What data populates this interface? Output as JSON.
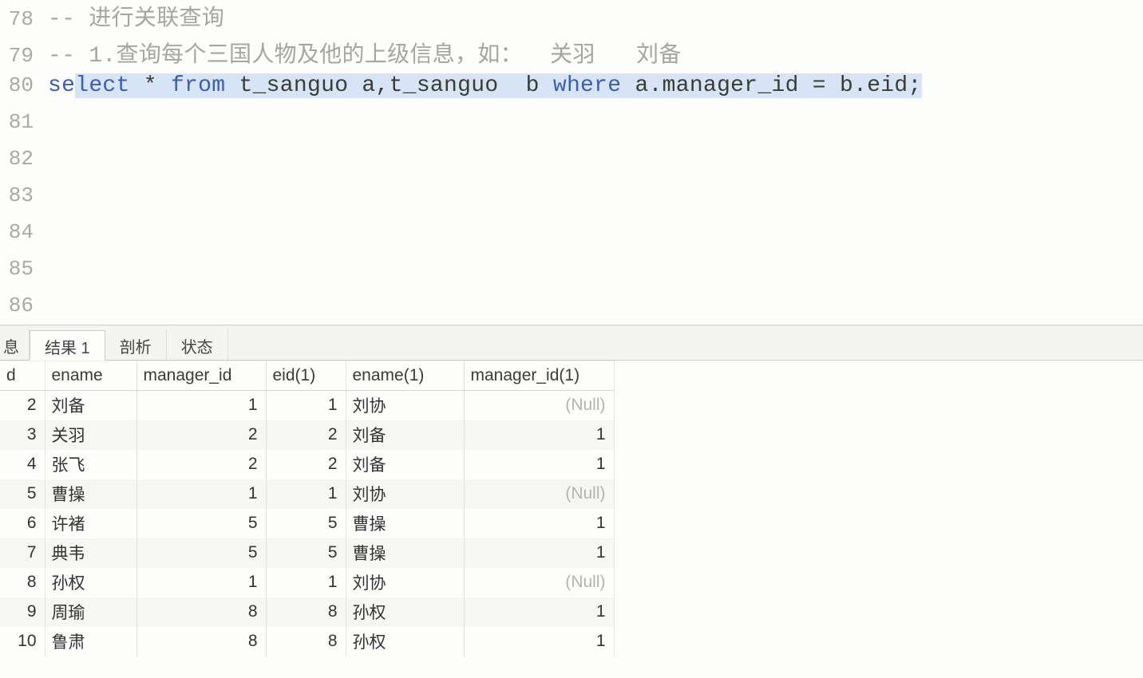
{
  "editor": {
    "lines": [
      {
        "n": "78",
        "tokens": [
          {
            "cls": "cm",
            "t": "-- 进行关联查询"
          }
        ]
      },
      {
        "n": "79",
        "tokens": [
          {
            "cls": "cm",
            "t": "-- 1.查询每个三国人物及他的上级信息，如：  关羽   刘备"
          }
        ]
      },
      {
        "n": "80",
        "selected": true,
        "unselPrefix": "se",
        "tokens": [
          {
            "cls": "kw",
            "t": "lect"
          },
          {
            "cls": "id",
            "t": " * "
          },
          {
            "cls": "kw",
            "t": "from"
          },
          {
            "cls": "id",
            "t": " t_sanguo a,t_sanguo  b "
          },
          {
            "cls": "kw",
            "t": "where"
          },
          {
            "cls": "id",
            "t": " a.manager_id = b.eid;"
          }
        ]
      },
      {
        "n": "81",
        "tokens": []
      },
      {
        "n": "82",
        "tokens": []
      },
      {
        "n": "83",
        "tokens": []
      },
      {
        "n": "84",
        "tokens": []
      },
      {
        "n": "85",
        "tokens": []
      },
      {
        "n": "86",
        "tokens": []
      }
    ]
  },
  "tabs": {
    "partialLeft": "息",
    "items": [
      {
        "label": "结果 1",
        "active": true
      },
      {
        "label": "剖析",
        "active": false
      },
      {
        "label": "状态",
        "active": false
      }
    ]
  },
  "result": {
    "null_label": "(Null)",
    "columns": [
      "d",
      "ename",
      "manager_id",
      "eid(1)",
      "ename(1)",
      "manager_id(1)"
    ],
    "rows": [
      {
        "c0": "2",
        "c1": "刘备",
        "c2": "1",
        "c3": "1",
        "c4": "刘协",
        "c5": null
      },
      {
        "c0": "3",
        "c1": "关羽",
        "c2": "2",
        "c3": "2",
        "c4": "刘备",
        "c5": "1"
      },
      {
        "c0": "4",
        "c1": "张飞",
        "c2": "2",
        "c3": "2",
        "c4": "刘备",
        "c5": "1"
      },
      {
        "c0": "5",
        "c1": "曹操",
        "c2": "1",
        "c3": "1",
        "c4": "刘协",
        "c5": null
      },
      {
        "c0": "6",
        "c1": "许褚",
        "c2": "5",
        "c3": "5",
        "c4": "曹操",
        "c5": "1"
      },
      {
        "c0": "7",
        "c1": "典韦",
        "c2": "5",
        "c3": "5",
        "c4": "曹操",
        "c5": "1"
      },
      {
        "c0": "8",
        "c1": "孙权",
        "c2": "1",
        "c3": "1",
        "c4": "刘协",
        "c5": null
      },
      {
        "c0": "9",
        "c1": "周瑜",
        "c2": "8",
        "c3": "8",
        "c4": "孙权",
        "c5": "1"
      },
      {
        "c0": "10",
        "c1": "鲁肃",
        "c2": "8",
        "c3": "8",
        "c4": "孙权",
        "c5": "1"
      }
    ]
  }
}
